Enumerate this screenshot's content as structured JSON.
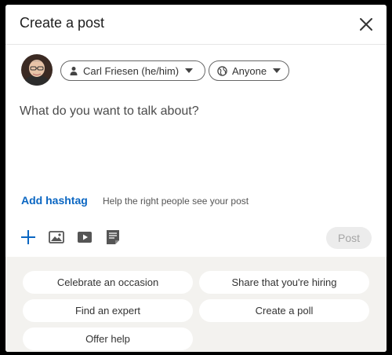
{
  "modal": {
    "title": "Create a post"
  },
  "author": {
    "name": "Carl Friesen (he/him)",
    "avatar_icon": "profile-photo"
  },
  "audience": {
    "label": "Anyone",
    "icon": "globe-icon"
  },
  "composer": {
    "placeholder": "What do you want to talk about?"
  },
  "hashtag": {
    "link_label": "Add hashtag",
    "hint": "Help the right people see your post"
  },
  "toolbar": {
    "items": [
      "plus-icon",
      "photo-icon",
      "video-icon",
      "document-icon"
    ],
    "post_label": "Post"
  },
  "suggestions": [
    "Celebrate an occasion",
    "Share that you're hiring",
    "Find an expert",
    "Create a poll",
    "Offer help"
  ],
  "colors": {
    "accent": "#0a66c2",
    "suggestions_bg": "#f3f2ef",
    "post_button_disabled_bg": "#ececec"
  }
}
